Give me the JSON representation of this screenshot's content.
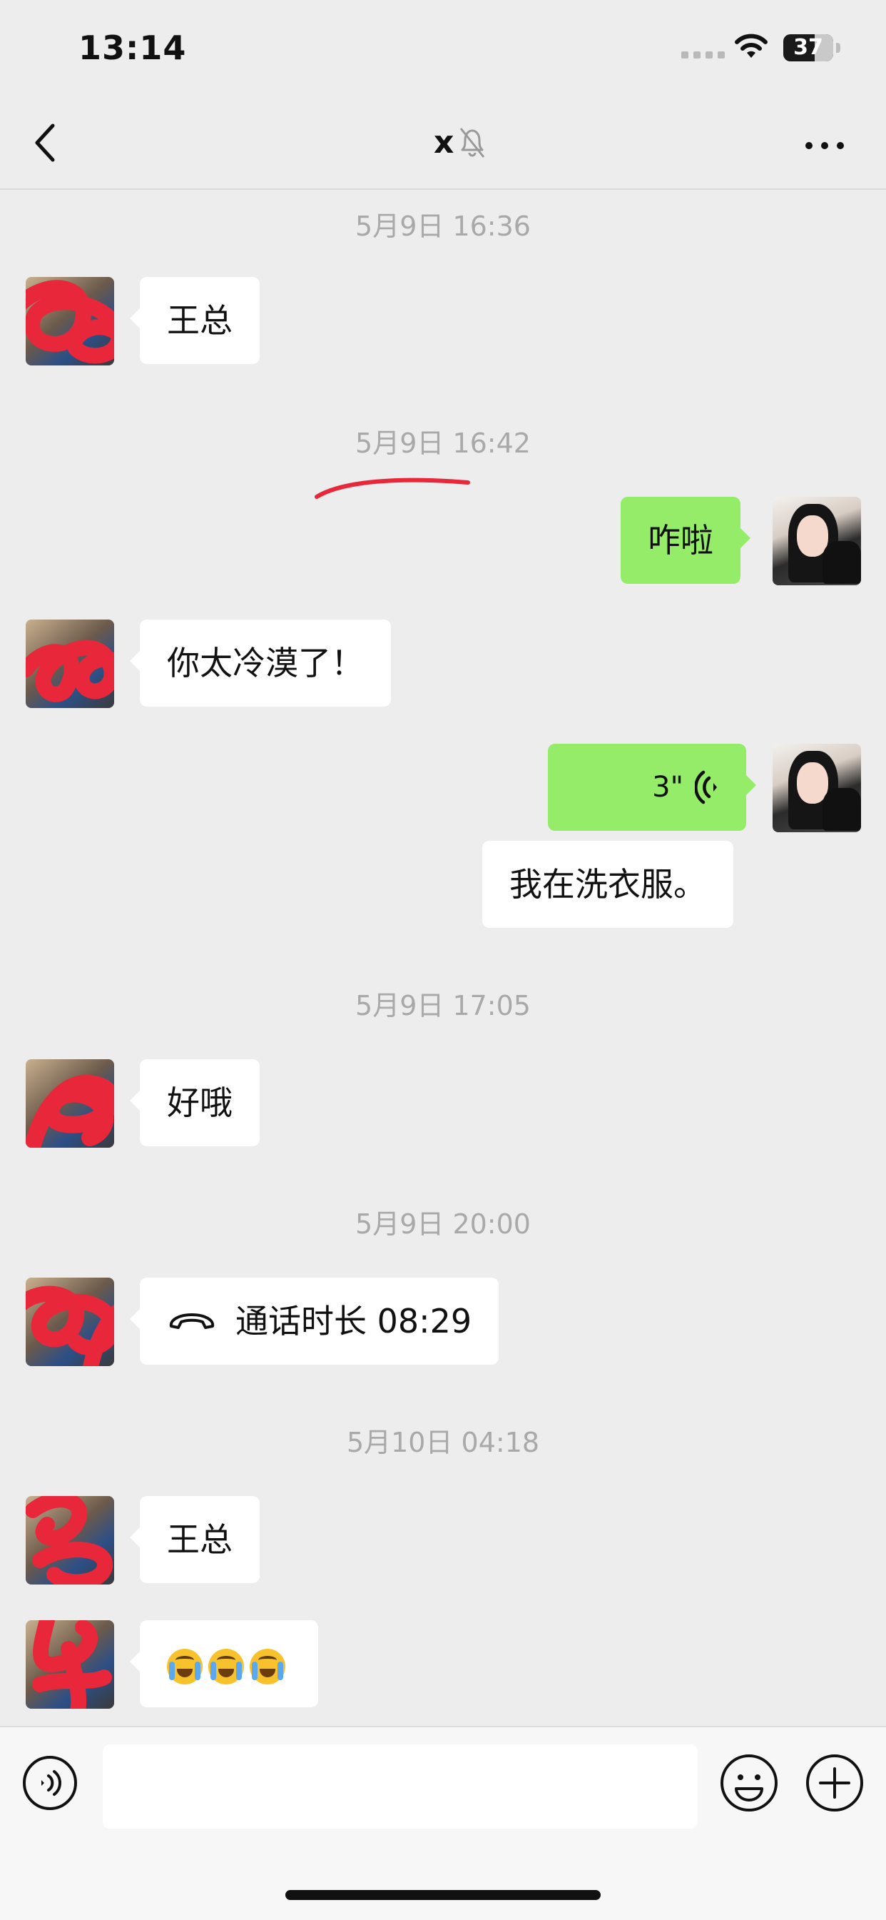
{
  "status_bar": {
    "time": "13:14",
    "battery": "37"
  },
  "nav": {
    "title": "x"
  },
  "messages": [
    {
      "timestamp": "5月9日 16:36",
      "text": "王总"
    },
    {
      "timestamp": "5月9日 16:42",
      "text": "咋啦"
    },
    {
      "text": "你太冷漠了！"
    },
    {
      "voice_duration": "3\""
    },
    {
      "text": "我在洗衣服。"
    },
    {
      "timestamp": "5月9日 17:05",
      "text": "好哦"
    },
    {
      "timestamp": "5月9日 20:00",
      "call_text": "通话时长 08:29"
    },
    {
      "timestamp": "5月10日 04:18",
      "text": "王总"
    },
    {
      "emoji_name": "crying-emoji"
    }
  ],
  "input": {
    "placeholder": ""
  },
  "colors": {
    "background": "#ededed",
    "sent_bubble": "#95ec69",
    "received_bubble": "#ffffff",
    "annotation": "#e8283a"
  }
}
